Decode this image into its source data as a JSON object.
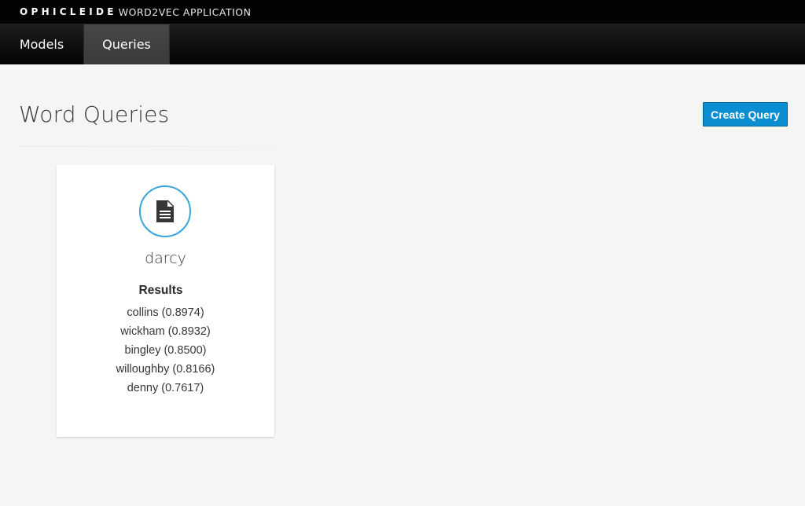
{
  "brand": {
    "name": "OPHICLEIDE",
    "app": "WORD2VEC APPLICATION"
  },
  "nav": {
    "tabs": [
      {
        "label": "Models"
      },
      {
        "label": "Queries"
      }
    ],
    "active": "Queries"
  },
  "page": {
    "title": "Word Queries",
    "create_label": "Create Query"
  },
  "query_card": {
    "icon": "file-text-icon",
    "name": "darcy",
    "results_heading": "Results",
    "results": [
      "collins (0.8974)",
      "wickham (0.8932)",
      "bingley (0.8500)",
      "willoughby (0.8166)",
      "denny (0.7617)"
    ]
  },
  "colors": {
    "accent": "#0a8dd1",
    "icon_ring": "#39a5dc",
    "background": "#f5f5f5",
    "topbar": "#030303"
  }
}
